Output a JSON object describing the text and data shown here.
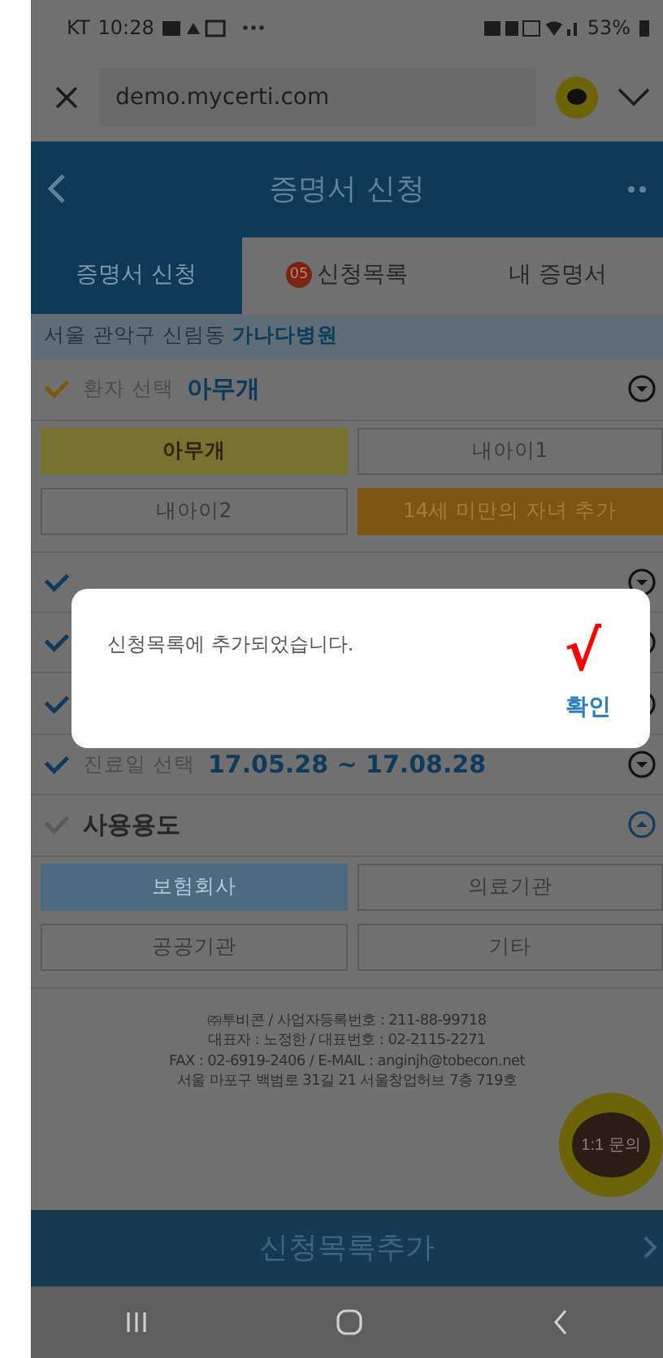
{
  "status_bar": {
    "carrier": "KT",
    "time": "10:28",
    "battery": "53%"
  },
  "browser": {
    "url": "demo.mycerti.com"
  },
  "header": {
    "title": "증명서 신청"
  },
  "tabs": [
    {
      "label": "증명서 신청",
      "selected": true
    },
    {
      "label": "신청목록",
      "badge": "05",
      "selected": false
    },
    {
      "label": "내 증명서",
      "selected": false
    }
  ],
  "location": "서울 관악구 신림동 **가나다병원**",
  "sections": [
    {
      "kind": "patient",
      "checked": true,
      "label": "환자 선택",
      "value": "아무개",
      "expanded": false,
      "options": [
        {
          "label": "아무개",
          "kind": "option",
          "selected": true
        },
        {
          "label": "내아이1",
          "kind": "option",
          "selected": false
        },
        {
          "label": "내아이2",
          "kind": "option",
          "selected": false
        },
        {
          "label": "14세 미만의 자녀 추가",
          "kind": "add"
        }
      ]
    },
    {
      "kind": "step",
      "checked": true,
      "expanded": false
    },
    {
      "kind": "step",
      "checked": true,
      "expanded": false
    },
    {
      "kind": "step",
      "checked": true,
      "expanded": false
    },
    {
      "kind": "step",
      "checked": true,
      "label": "진료일 선택",
      "value": "17.05.28 ~ 17.08.28",
      "expanded": false
    },
    {
      "kind": "usage",
      "checked": false,
      "title": "사용용도",
      "expanded": true,
      "options": [
        {
          "label": "보험회사",
          "kind": "option",
          "selected": true
        },
        {
          "label": "의료기관",
          "kind": "option",
          "selected": false
        },
        {
          "label": "공공기관",
          "kind": "option",
          "selected": false
        },
        {
          "label": "기타",
          "kind": "option",
          "selected": false
        }
      ]
    }
  ],
  "footer": [
    "㈜투비콘 / 사업자등록번호 : 211-88-99718",
    "대표자 : 노정한 / 대표번호 : 02-2115-2271",
    "FAX : 02-6919-2406 / E-MAIL : anginjh@tobecon.net",
    "서울 마포구 백범로 31길 21 서울창업허브 7층 719호"
  ],
  "chat_button": "1:1 문의",
  "bottom_button": "신청목록추가",
  "dialog": {
    "message": "신청목록에 추가되었습니다.",
    "mark": "√",
    "button": "확인"
  }
}
